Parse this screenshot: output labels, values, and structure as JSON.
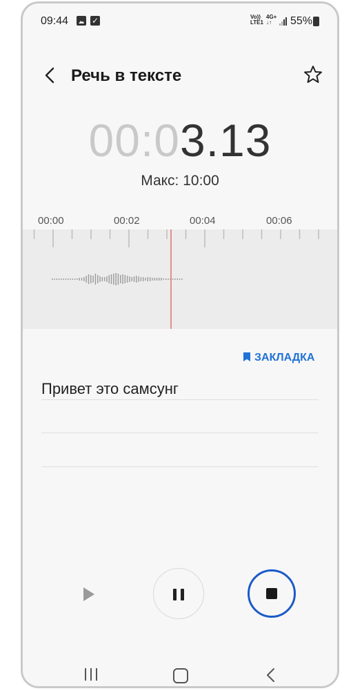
{
  "status_bar": {
    "time": "09:44",
    "icons": [
      "gallery-icon",
      "check-icon",
      "volte-icon",
      "4g-icon",
      "signal-icon",
      "battery-icon"
    ],
    "volte_top": "Vo))",
    "volte_bottom": "LTE1",
    "net_top": "4G+",
    "net_bottom": "↓↑",
    "battery": "55%"
  },
  "header": {
    "title": "Речь в тексте",
    "back_icon": "chevron-left-icon",
    "favorite_icon": "star-outline-icon"
  },
  "timer": {
    "dim_part": "00:0",
    "bright_part": "3.13",
    "max_label": "Макс: 10:00"
  },
  "timeline": {
    "labels": [
      "00:00",
      "00:02",
      "00:04",
      "00:06"
    ],
    "playhead_color": "#e07070"
  },
  "bookmark": {
    "label": "ЗАКЛАДКА",
    "icon": "bookmark-icon",
    "color": "#1f72d8"
  },
  "transcript": {
    "text": "Привет это самсунг"
  },
  "controls": {
    "play_icon": "play-icon",
    "pause_icon": "pause-icon",
    "stop_icon": "stop-icon",
    "stop_ring_color": "#1a5ac8"
  },
  "nav": {
    "recent_icon": "recent-apps-icon",
    "home_icon": "home-icon",
    "back_icon": "back-icon"
  }
}
